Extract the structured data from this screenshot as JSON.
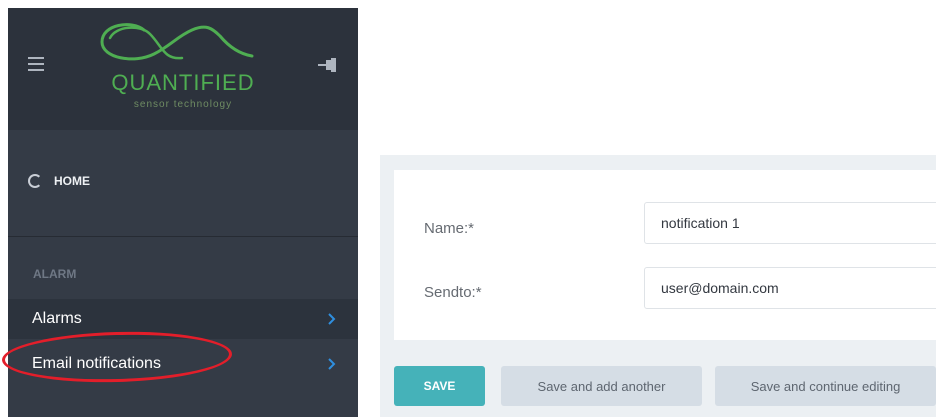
{
  "sidebar": {
    "logo": {
      "name": "QUANTIFIED",
      "tagline": "sensor technology",
      "color": "#4fae52"
    },
    "icons": {
      "menu": "hamburger-menu-icon",
      "pin": "pin-icon",
      "home": "circle-spinner-icon",
      "chevron": "chevron-right-icon"
    },
    "home_label": "HOME",
    "section_label": "ALARM",
    "items": [
      {
        "label": "Alarms"
      },
      {
        "label": "Email notifications",
        "highlighted": true
      }
    ],
    "highlight_color": "#e31e2a"
  },
  "form": {
    "fields": [
      {
        "label": "Name:*",
        "value": "notification 1"
      },
      {
        "label": "Sendto:*",
        "value": "user@domain.com"
      }
    ]
  },
  "buttons": {
    "save": "SAVE",
    "add_another": "Save and add another",
    "continue": "Save and continue editing"
  },
  "colors": {
    "sidebar_bg": "#343b46",
    "accent": "#45b2b9",
    "secondary_button": "#d5dde5"
  }
}
